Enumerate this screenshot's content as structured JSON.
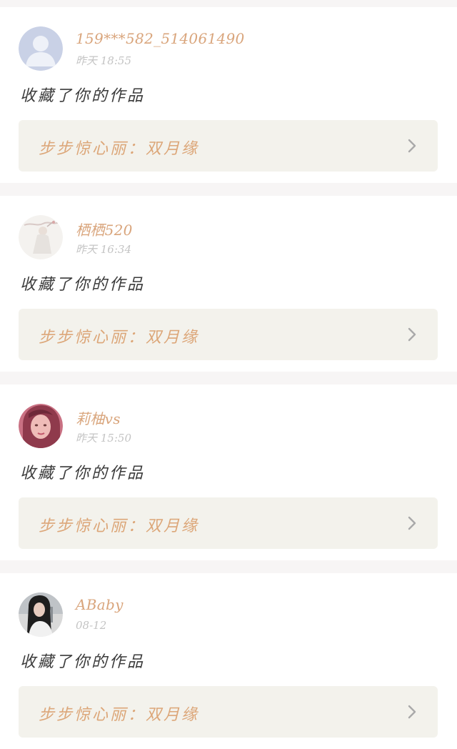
{
  "notifications": [
    {
      "username": "159***582_514061490",
      "time": "昨天 18:55",
      "action": "收藏了你的作品",
      "work_title": "步步惊心丽：双月缘",
      "avatar": "default-person-avatar"
    },
    {
      "username": "栖栖520",
      "time": "昨天 16:34",
      "action": "收藏了你的作品",
      "work_title": "步步惊心丽：双月缘",
      "avatar": "illustrated-figure-avatar"
    },
    {
      "username": "莉柚vs",
      "time": "昨天 15:50",
      "action": "收藏了你的作品",
      "work_title": "步步惊心丽：双月缘",
      "avatar": "pink-portrait-avatar"
    },
    {
      "username": "ABaby",
      "time": "08-12",
      "action": "收藏了你的作品",
      "work_title": "步步惊心丽：双月缘",
      "avatar": "dark-hair-portrait-avatar"
    }
  ],
  "colors": {
    "username": "#d9a57c",
    "work_title": "#dca678",
    "time": "#c4c4c4",
    "action": "#3a3a3a",
    "link_background": "#f3f2ec",
    "separator": "#f7f5f5"
  },
  "icons": {
    "chevron": "chevron-right-icon"
  }
}
